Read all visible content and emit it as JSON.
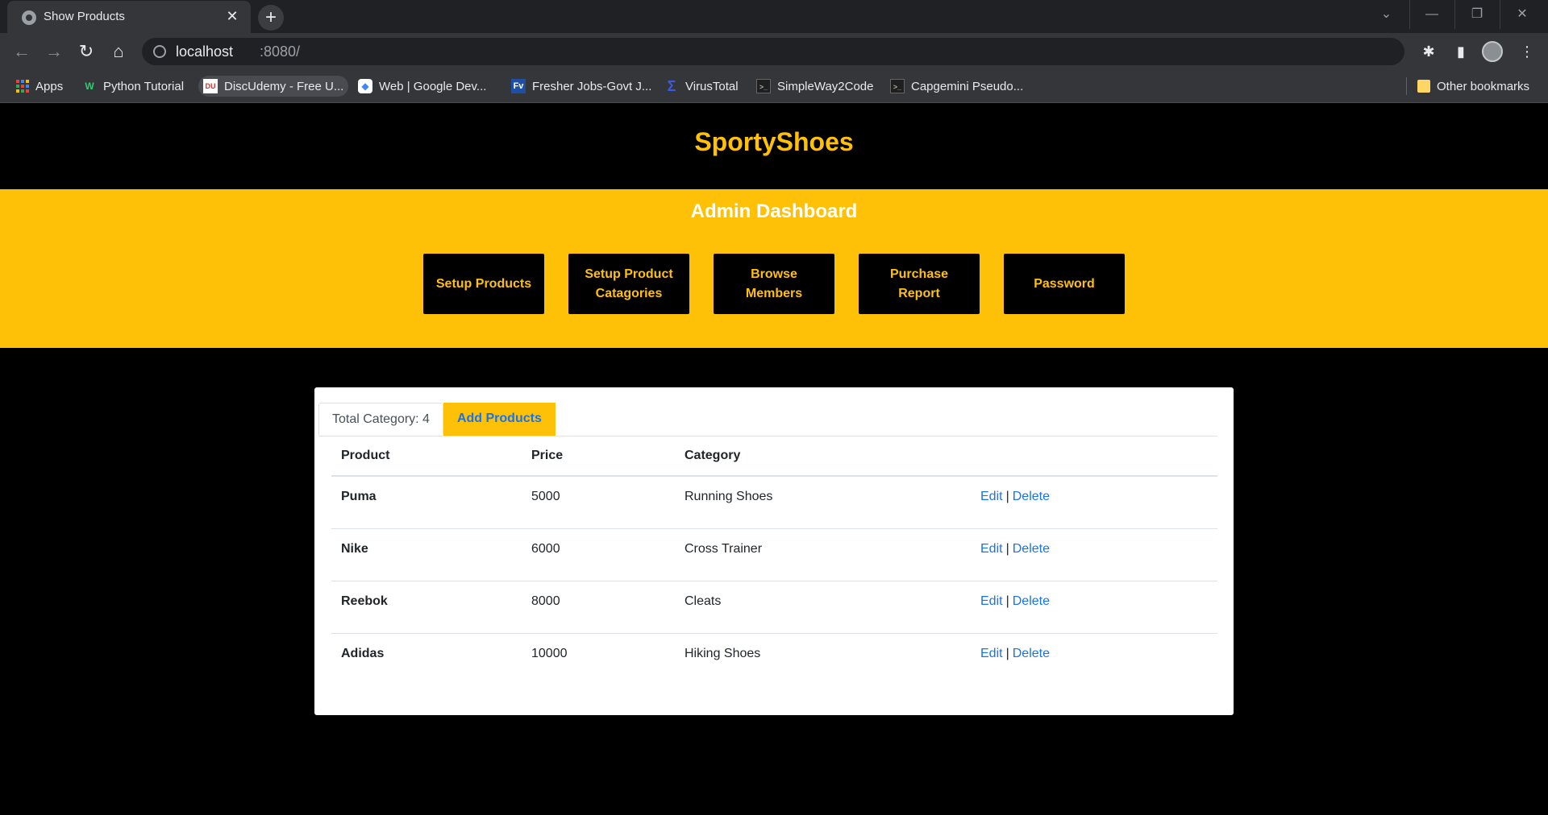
{
  "browser": {
    "tab_title": "Show Products",
    "tab_close": "✕",
    "new_tab": "+",
    "url_host": "localhost",
    "url_port": ":8080/",
    "bookmarks": [
      {
        "label": "Apps",
        "icon": "apps-grid-icon"
      },
      {
        "label": "Python Tutorial",
        "icon": "w-icon",
        "glyph": "W"
      },
      {
        "label": "DiscUdemy - Free U...",
        "icon": "discudemy-icon",
        "glyph": "DU"
      },
      {
        "label": "Web | Google Dev...",
        "icon": "google-dev-icon",
        "glyph": "◆"
      },
      {
        "label": "Fresher Jobs-Govt J...",
        "icon": "fv-icon",
        "glyph": "Fv"
      },
      {
        "label": "VirusTotal",
        "icon": "virustotal-icon",
        "glyph": "Σ"
      },
      {
        "label": "SimpleWay2Code",
        "icon": "terminal-icon",
        "glyph": ">_"
      },
      {
        "label": "Capgemini Pseudo...",
        "icon": "terminal-icon",
        "glyph": ">_"
      }
    ],
    "other_bookmarks": "Other bookmarks"
  },
  "site": {
    "brand": "SportyShoes",
    "dashboard_title": "Admin Dashboard",
    "dashboard_buttons": [
      "Setup Products",
      "Setup Product Catagories",
      "Browse Members",
      "Purchase Report",
      "Password"
    ]
  },
  "products_card": {
    "tab_total": "Total Category: 4",
    "tab_add": "Add Products",
    "headers": [
      "Product",
      "Price",
      "Category",
      ""
    ],
    "edit_label": "Edit",
    "separator": "|",
    "delete_label": "Delete",
    "rows": [
      {
        "product": "Puma",
        "price": "5000",
        "category": "Running Shoes"
      },
      {
        "product": "Nike",
        "price": "6000",
        "category": "Cross Trainer"
      },
      {
        "product": "Reebok",
        "price": "8000",
        "category": "Cleats"
      },
      {
        "product": "Adidas",
        "price": "10000",
        "category": "Hiking Shoes"
      }
    ]
  },
  "colors": {
    "accent": "#ffc107",
    "link": "#1a73e8",
    "page_bg": "#000000"
  }
}
